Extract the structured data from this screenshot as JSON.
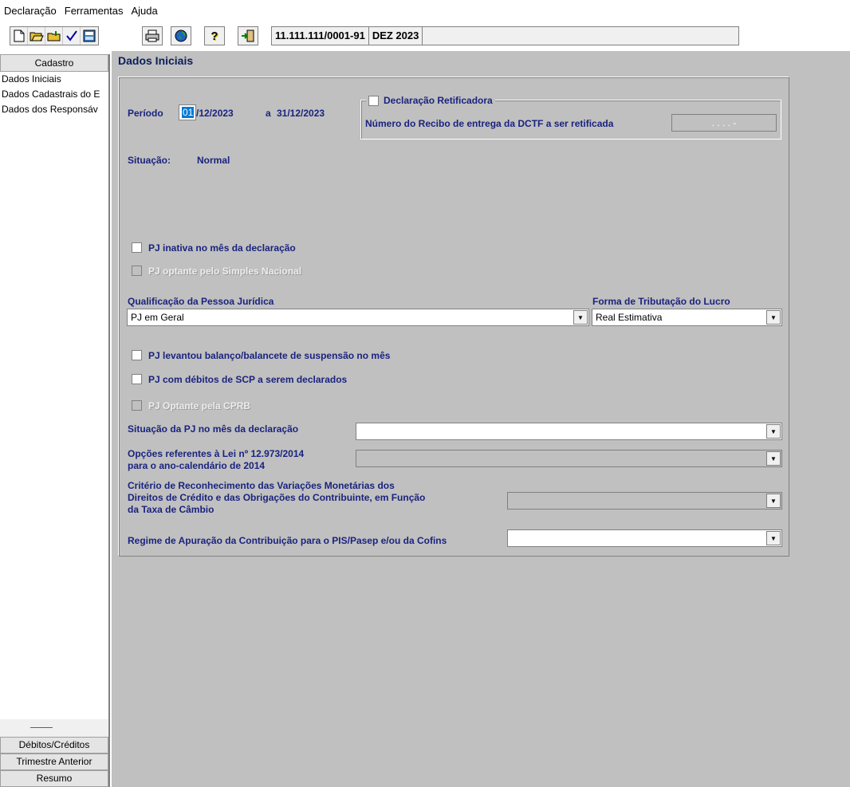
{
  "menu": {
    "items": [
      "Declaração",
      "Ferramentas",
      "Ajuda"
    ]
  },
  "toolbar": {
    "cnpj": "11.111.111/0001-91",
    "period": "DEZ 2023",
    "extra": ""
  },
  "sidebar": {
    "header": "Cadastro",
    "items": [
      "Dados Iniciais",
      "Dados Cadastrais do E",
      "Dados dos Responsáv"
    ],
    "bottom_buttons": [
      "Débitos/Créditos",
      "Trimestre Anterior",
      "Resumo"
    ]
  },
  "main": {
    "title": "Dados Iniciais",
    "periodo_label": "Período",
    "periodo_day": "01",
    "periodo_rest": "/12/2023",
    "a_label": "a",
    "periodo_end": "31/12/2023",
    "retificadora_label": "Declaração Retificadora",
    "recibo_label": "Número do Recibo de entrega da DCTF a ser retificada",
    "recibo_value": ". . . . -",
    "situacao_label": "Situação:",
    "situacao_value": "Normal",
    "pj_inativa": "PJ inativa no mês da declaração",
    "pj_simples": "PJ optante pelo Simples Nacional",
    "qualificacao_label": "Qualificação da Pessoa Jurídica",
    "qualificacao_value": "PJ em Geral",
    "forma_label": "Forma de Tributação do Lucro",
    "forma_value": "Real Estimativa",
    "pj_balanco": "PJ levantou balanço/balancete de suspensão no mês",
    "pj_scp": "PJ com débitos de SCP a serem declarados",
    "pj_cprb": "PJ Optante pela CPRB",
    "situacao_pj_label": "Situação da PJ no mês da declaração",
    "opcoes_label_1": "Opções referentes à Lei nº 12.973/2014",
    "opcoes_label_2": "para o ano-calendário de 2014",
    "criterio_label_1": "Critério de Reconhecimento das Variações Monetárias dos",
    "criterio_label_2": "Direitos de Crédito e das Obrigações do Contribuinte, em Função",
    "criterio_label_3": "da Taxa de Câmbio",
    "regime_label": "Regime de Apuração da Contribuição para o PIS/Pasep e/ou da Cofins"
  }
}
